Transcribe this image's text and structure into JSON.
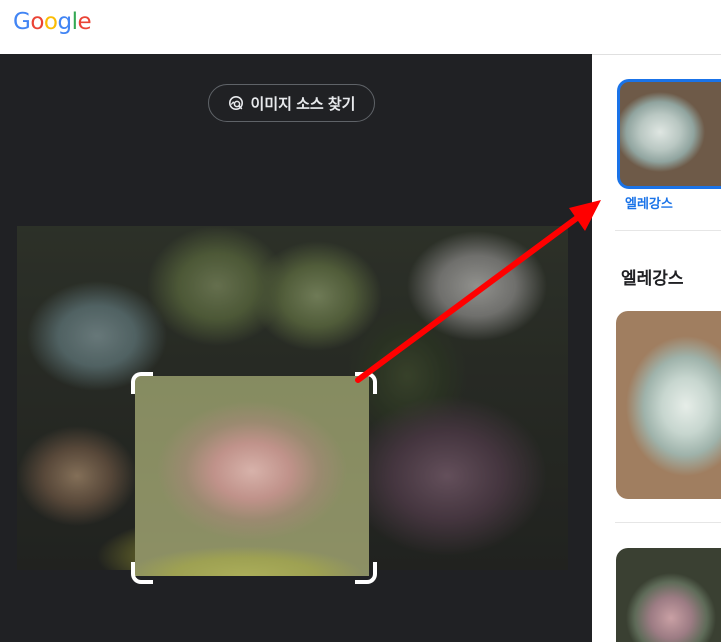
{
  "header": {
    "logo_letters": [
      {
        "char": "G",
        "color": "#4285F4"
      },
      {
        "char": "o",
        "color": "#EA4335"
      },
      {
        "char": "o",
        "color": "#FBBC05"
      },
      {
        "char": "g",
        "color": "#4285F4"
      },
      {
        "char": "l",
        "color": "#34A853"
      },
      {
        "char": "e",
        "color": "#EA4335"
      }
    ]
  },
  "viewer": {
    "find_source_label": "이미지 소스 찾기",
    "find_source_icon": "image-search-icon"
  },
  "results": {
    "chip_label": "엘레강스",
    "section_title": "엘레강스"
  },
  "annotation": {
    "arrow_color": "#ff0000"
  },
  "colors": {
    "accent": "#1a73e8",
    "viewer_background": "#202124"
  }
}
